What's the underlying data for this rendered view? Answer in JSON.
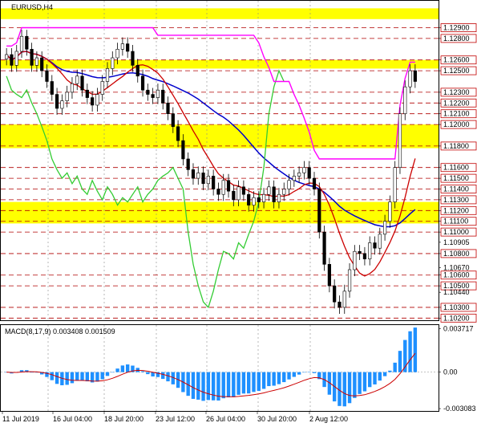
{
  "header": {
    "symbol_label": "EURUSD,H4"
  },
  "macd_panel": {
    "label": "MACD(8,17,9) 0.003408 0.001509"
  },
  "chart_data": [
    {
      "type": "candlestick",
      "title": "EURUSD,H4",
      "ylim": [
        1.1018,
        1.1315
      ],
      "price_axis_labels": [
        "1.12900",
        "1.12800",
        "1.12600",
        "1.12500",
        "1.12300",
        "1.12200",
        "1.12100",
        "1.12000",
        "1.11800",
        "1.11600",
        "1.11500",
        "1.11400",
        "1.11300",
        "1.11200",
        "1.11100",
        "1.11000",
        "1.10905",
        "1.10800",
        "1.10670",
        "1.10600",
        "1.10500",
        "1.10440",
        "1.10300",
        "1.10200"
      ],
      "price_axis_values": [
        1.129,
        1.128,
        1.126,
        1.125,
        1.123,
        1.122,
        1.121,
        1.12,
        1.118,
        1.116,
        1.115,
        1.114,
        1.113,
        1.112,
        1.111,
        1.11,
        1.10905,
        1.108,
        1.1067,
        1.106,
        1.105,
        1.1044,
        1.103,
        1.102
      ],
      "boxed_labels": [
        "1.12900",
        "1.12800",
        "1.12600",
        "1.12500",
        "1.12300",
        "1.12200",
        "1.12100",
        "1.12000",
        "1.11800",
        "1.11600",
        "1.11500",
        "1.11400",
        "1.11300",
        "1.11200",
        "1.11100",
        "1.11000",
        "1.10800",
        "1.10600",
        "1.10500",
        "1.10300",
        "1.10200"
      ],
      "support_resistance_levels": [
        1.129,
        1.128,
        1.126,
        1.125,
        1.123,
        1.122,
        1.121,
        1.12,
        1.118,
        1.116,
        1.115,
        1.114,
        1.113,
        1.112,
        1.111,
        1.11,
        1.108,
        1.106,
        1.105,
        1.103,
        1.102
      ],
      "yellow_zones": [
        [
          1.1298,
          1.1308
        ],
        [
          1.1252,
          1.126
        ],
        [
          1.1178,
          1.12
        ],
        [
          1.1108,
          1.1128
        ]
      ],
      "x_labels": [
        "11 Jul 2019",
        "16 Jul 04:00",
        "18 Jul 20:00",
        "23 Jul 12:00",
        "26 Jul 04:00",
        "30 Jul 20:00",
        "2 Aug 12:00"
      ],
      "close": [
        1.1265,
        1.1255,
        1.1268,
        1.1282,
        1.127,
        1.1255,
        1.1262,
        1.125,
        1.124,
        1.1228,
        1.1215,
        1.1222,
        1.123,
        1.1238,
        1.1245,
        1.1232,
        1.1225,
        1.1218,
        1.1228,
        1.124,
        1.1252,
        1.1262,
        1.127,
        1.1275,
        1.1268,
        1.1255,
        1.1245,
        1.1232,
        1.1228,
        1.1225,
        1.1232,
        1.122,
        1.121,
        1.1198,
        1.1185,
        1.1168,
        1.1158,
        1.115,
        1.1155,
        1.1145,
        1.1152,
        1.114,
        1.1135,
        1.1148,
        1.1138,
        1.113,
        1.1142,
        1.1135,
        1.1125,
        1.1132,
        1.1128,
        1.1135,
        1.1142,
        1.1128,
        1.1135,
        1.114,
        1.1148,
        1.1152,
        1.1155,
        1.116,
        1.115,
        1.114,
        1.11,
        1.107,
        1.105,
        1.1035,
        1.103,
        1.1045,
        1.1065,
        1.1082,
        1.108,
        1.1075,
        1.109,
        1.1085,
        1.1098,
        1.111,
        1.1128,
        1.116,
        1.121,
        1.1235,
        1.125,
        1.124
      ],
      "series": [
        {
          "name": "EURUSD H4",
          "color": "#000000"
        },
        {
          "color": "#0000cc"
        },
        {
          "color": "#cc0000"
        },
        {
          "color": "#33cc33"
        },
        {
          "color": "#ff00ff"
        }
      ]
    },
    {
      "type": "histogram",
      "title": "MACD(8,17,9)",
      "macd_value": 0.003408,
      "signal_value": 0.001509,
      "axis_labels": [
        "0.003717",
        "0.00",
        "-0.003083"
      ],
      "ylim": [
        -0.0033,
        0.004
      ],
      "colors": {
        "histogram": "#1e90ff",
        "signal": "#cc0000"
      }
    }
  ]
}
